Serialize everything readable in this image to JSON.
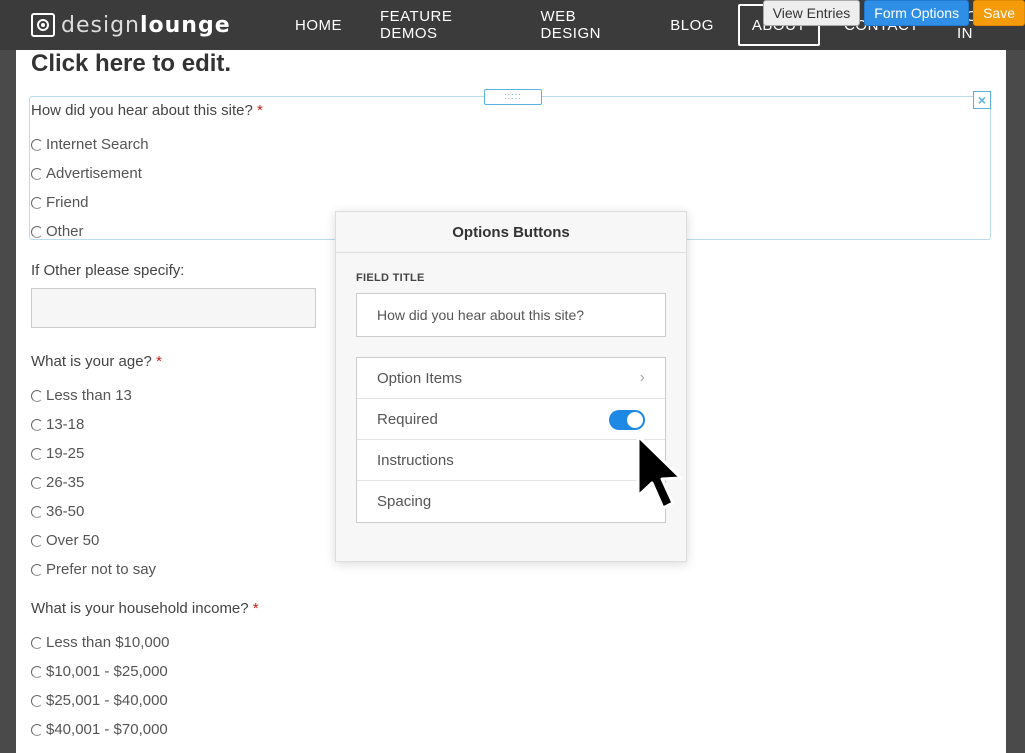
{
  "header": {
    "logo_light": "design",
    "logo_bold": "lounge",
    "nav": [
      "HOME",
      "FEATURE DEMOS",
      "WEB DESIGN",
      "BLOG",
      "ABOUT",
      "CONTACT",
      "LOG IN"
    ],
    "admin_buttons": {
      "view_entries": "View Entries",
      "form_options": "Form Options",
      "save": "Save"
    }
  },
  "form": {
    "edit_title": "Click here to edit.",
    "q1": {
      "label": "How did you hear about this site?",
      "required_mark": "*",
      "options": [
        "Internet Search",
        "Advertisement",
        "Friend",
        "Other"
      ]
    },
    "other_label": "If Other please specify:",
    "q2": {
      "label": "What is your age?",
      "required_mark": "*",
      "options": [
        "Less than 13",
        "13-18",
        "19-25",
        "26-35",
        "36-50",
        "Over 50",
        "Prefer not to say"
      ]
    },
    "q3": {
      "label": "What is your household income?",
      "required_mark": "*",
      "options": [
        "Less than $10,000",
        "$10,001 - $25,000",
        "$25,001 - $40,000",
        "$40,001 - $70,000"
      ]
    }
  },
  "popover": {
    "title": "Options Buttons",
    "field_title_label": "FIELD TITLE",
    "field_title_value": "How did you hear about this site?",
    "rows": [
      "Option Items",
      "Required",
      "Instructions",
      "Spacing"
    ],
    "required_on": true
  },
  "colors": {
    "accent": "#1e88e5",
    "required": "#d01a1a",
    "save_button": "#f59b0a"
  }
}
